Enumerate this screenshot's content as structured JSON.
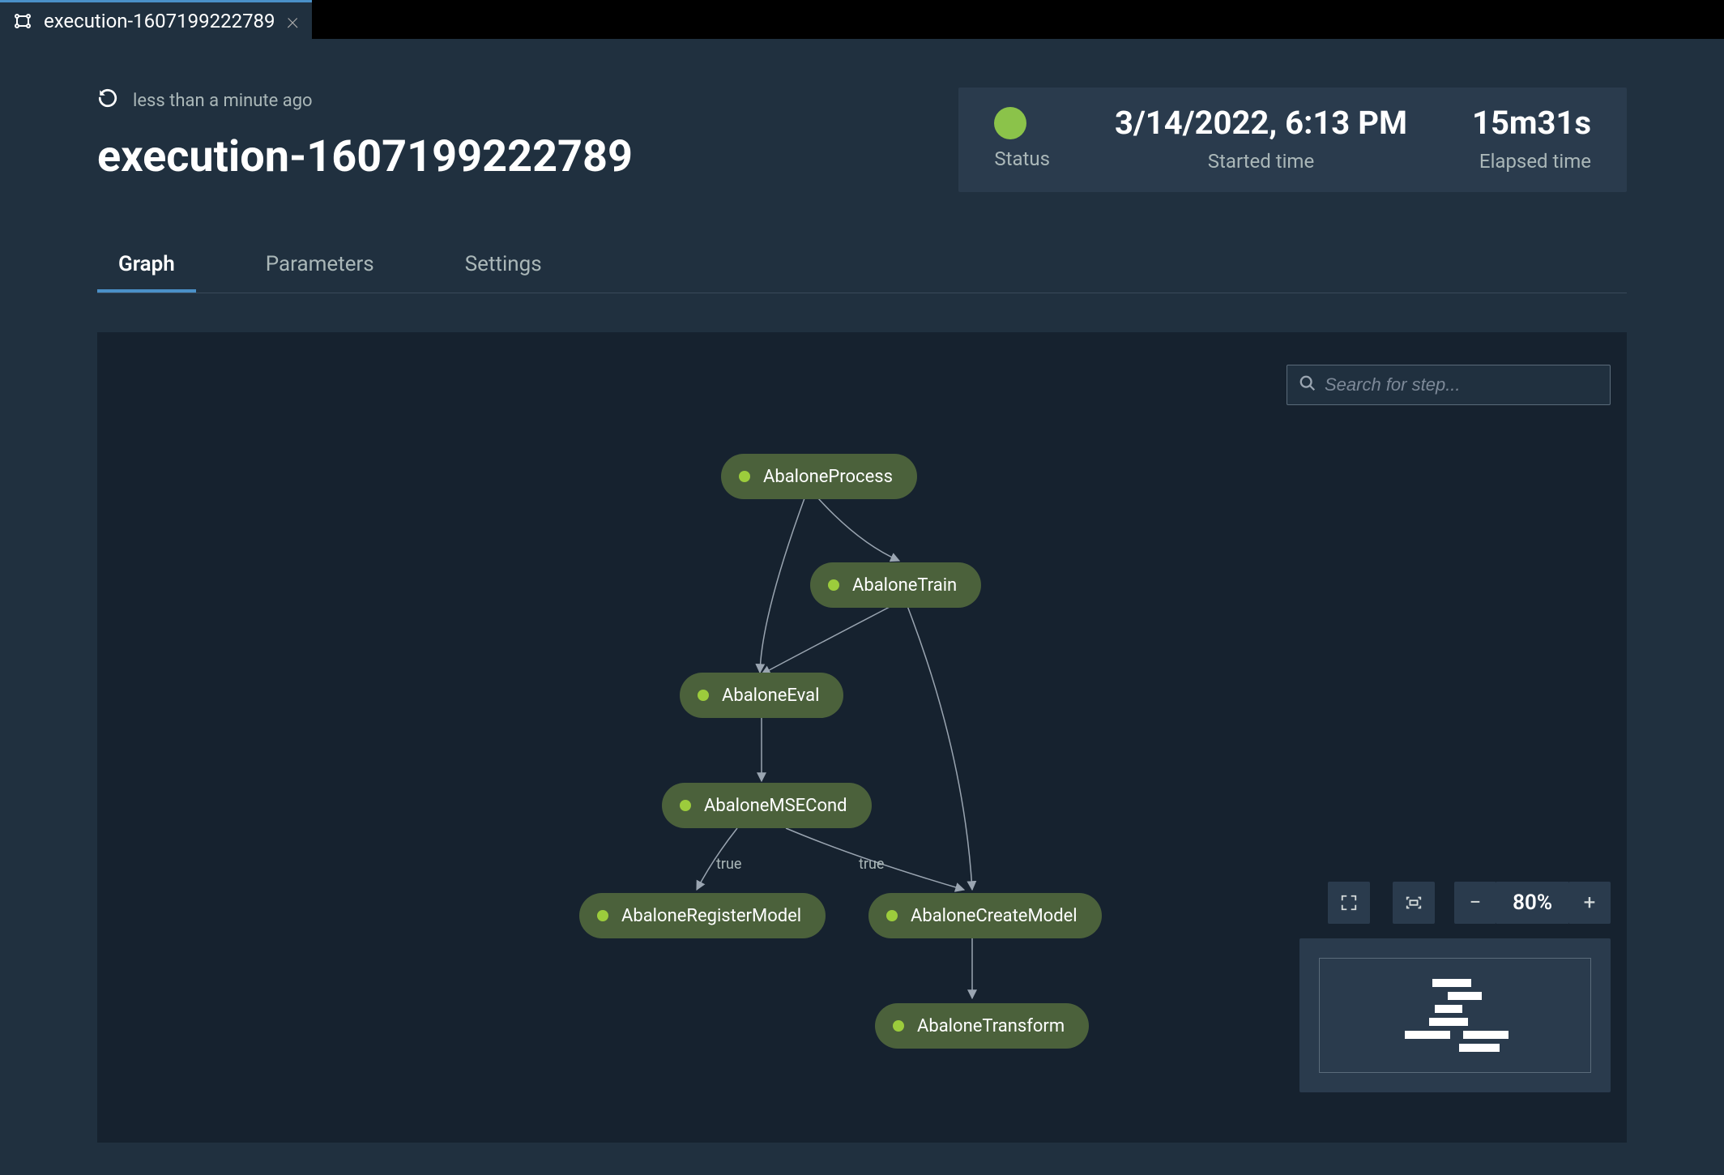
{
  "tab": {
    "title": "execution-1607199222789"
  },
  "refresh": {
    "text": "less than a minute ago"
  },
  "page": {
    "title": "execution-1607199222789"
  },
  "status": {
    "status_label": "Status",
    "started_value": "3/14/2022, 6:13 PM",
    "started_label": "Started time",
    "elapsed_value": "15m31s",
    "elapsed_label": "Elapsed time"
  },
  "tabs": {
    "graph": "Graph",
    "parameters": "Parameters",
    "settings": "Settings"
  },
  "search": {
    "placeholder": "Search for step..."
  },
  "zoom": {
    "level": "80%"
  },
  "nodes": {
    "process": "AbaloneProcess",
    "train": "AbaloneTrain",
    "eval": "AbaloneEval",
    "msecond": "AbaloneMSECond",
    "register": "AbaloneRegisterModel",
    "create": "AbaloneCreateModel",
    "transform": "AbaloneTransform"
  },
  "edge_labels": {
    "true1": "true",
    "true2": "true"
  }
}
